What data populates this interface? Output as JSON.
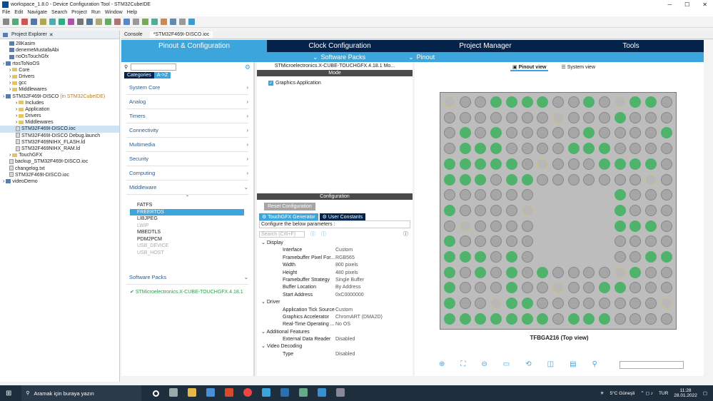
{
  "title": "workspace_1.8.0 - Device Configuration Tool - STM32CubeIDE",
  "menu": [
    "File",
    "Edit",
    "Navigate",
    "Search",
    "Project",
    "Run",
    "Window",
    "Help"
  ],
  "explorer": {
    "tab": "Project Explorer",
    "items": [
      {
        "l": "28Kasim",
        "d": 1,
        "t": "p"
      },
      {
        "l": "denemeMustafaAbi",
        "d": 1,
        "t": "p"
      },
      {
        "l": "noOsTouchGfx",
        "d": 1,
        "t": "p"
      },
      {
        "l": "rtosToNoOS",
        "d": 0,
        "t": "p"
      },
      {
        "l": "Core",
        "d": 1,
        "t": "f"
      },
      {
        "l": "Drivers",
        "d": 1,
        "t": "f"
      },
      {
        "l": "gcc",
        "d": 1,
        "t": "f"
      },
      {
        "l": "Middlewares",
        "d": 1,
        "t": "f"
      },
      {
        "l": "STM32F469I-DISCO",
        "d": 0,
        "t": "p",
        "s": "(in STM32CubeIDE)"
      },
      {
        "l": "Includes",
        "d": 2,
        "t": "f"
      },
      {
        "l": "Application",
        "d": 2,
        "t": "f"
      },
      {
        "l": "Drivers",
        "d": 2,
        "t": "f"
      },
      {
        "l": "Middlewares",
        "d": 2,
        "t": "f"
      },
      {
        "l": "STM32F469I-DISCO.ioc",
        "d": 2,
        "t": "x",
        "sel": true
      },
      {
        "l": "STM32F469I-DISCO Debug.launch",
        "d": 2,
        "t": "x"
      },
      {
        "l": "STM32F469NIHX_FLASH.ld",
        "d": 2,
        "t": "x"
      },
      {
        "l": "STM32F469NIHX_RAM.ld",
        "d": 2,
        "t": "x"
      },
      {
        "l": "TouchGFX",
        "d": 1,
        "t": "f"
      },
      {
        "l": "backup_STM32F469I-DISCO.ioc",
        "d": 1,
        "t": "x"
      },
      {
        "l": "changelog.txt",
        "d": 1,
        "t": "x"
      },
      {
        "l": "STM32F469I-DISCO.ioc",
        "d": 1,
        "t": "x"
      },
      {
        "l": "videoDemo",
        "d": 0,
        "t": "p"
      }
    ]
  },
  "editor_tabs": [
    "Console",
    "*STM32F469I-DISCO.ioc"
  ],
  "main_tabs": [
    "Pinout & Configuration",
    "Clock Configuration",
    "Project Manager",
    "Tools"
  ],
  "sub_tabs": [
    "Software Packs",
    "Pinout"
  ],
  "left": {
    "cat_tabs": [
      "Categories",
      "A->Z"
    ],
    "categories": [
      "System Core",
      "Analog",
      "Timers",
      "Connectivity",
      "Multimedia",
      "Security",
      "Computing",
      "Middleware"
    ],
    "middleware": [
      {
        "l": "FATFS"
      },
      {
        "l": "FREERTOS",
        "hl": true
      },
      {
        "l": "LIBJPEG"
      },
      {
        "l": "LWIP",
        "dis": true
      },
      {
        "l": "MBEDTLS"
      },
      {
        "l": "PDM2PCM"
      },
      {
        "l": "USB_DEVICE",
        "dis": true
      },
      {
        "l": "USB_HOST",
        "dis": true
      }
    ],
    "sw_packs": "Software Packs",
    "pack_item": "STMicroelectronics.X-CUBE-TOUCHGFX.4.18.1"
  },
  "mid": {
    "title": "STMicroelectronics.X-CUBE-TOUCHGFX.4.18.1 Mo...",
    "mode": "Mode",
    "graphics": "Graphics Application",
    "config": "Configuration",
    "reset": "Reset Configuration",
    "tabs": [
      "TouchGFX Generator",
      "User Constants"
    ],
    "hint": "Configure the below parameters :",
    "search_ph": "Search (Crtl+F)",
    "groups": [
      {
        "name": "Display",
        "rows": [
          [
            "Interface",
            "Custom"
          ],
          [
            "Framebuffer Pixel For...",
            "RGB565"
          ],
          [
            "Width",
            "800 pixels"
          ],
          [
            "Height",
            "480 pixels"
          ],
          [
            "Framebuffer Strategy",
            "Single Buffer"
          ],
          [
            "Buffer Location",
            "By Address"
          ],
          [
            "Start Address",
            "0xC0000000"
          ]
        ]
      },
      {
        "name": "Driver",
        "rows": [
          [
            "Application Tick Source",
            "Custom"
          ],
          [
            "Graphics Accelerator",
            "ChromART (DMA2D)"
          ],
          [
            "Real-Time Operating ...",
            "No OS"
          ]
        ]
      },
      {
        "name": "Additional Features",
        "rows": [
          [
            "External Data Reader",
            "Disabled"
          ]
        ]
      },
      {
        "name": "Video Decoding",
        "rows": [
          [
            "Type",
            "Disabled"
          ]
        ]
      }
    ]
  },
  "right": {
    "views": [
      "Pinout view",
      "System view"
    ],
    "caption": "TFBGA216 (Top view)"
  },
  "taskbar": {
    "search": "Aramak için buraya yazın",
    "weather": "5°C Güneşli",
    "lang": "TUR",
    "time": "11:28",
    "date": "28.01.2022"
  },
  "colors": {
    "accent": "#3ca6dc",
    "dark": "#03234b",
    "pin_green": "#4fb36b"
  }
}
